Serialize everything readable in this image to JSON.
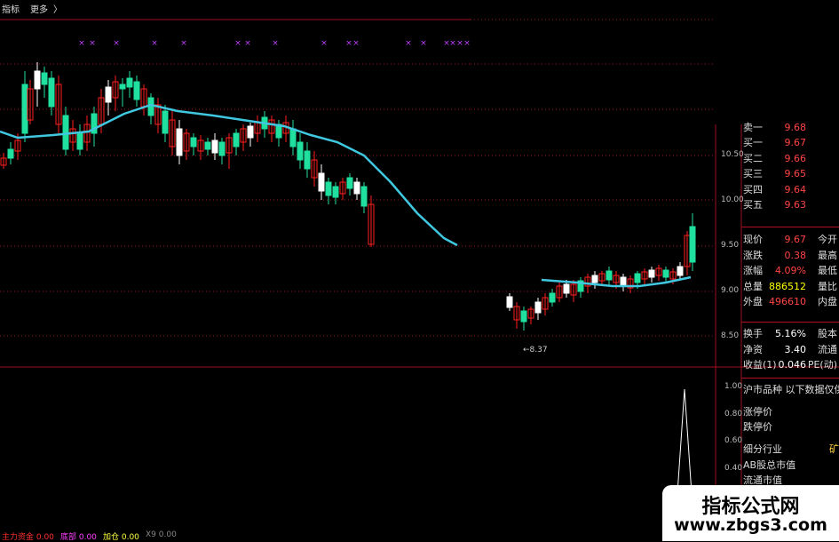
{
  "toolbar": {
    "item1": "指标",
    "item2": "更多",
    "item3": "〉"
  },
  "price_axis": [
    {
      "label": "10.50",
      "value": 10.5
    },
    {
      "label": "10.00",
      "value": 10.0
    },
    {
      "label": "9.50",
      "value": 9.5
    },
    {
      "label": "9.00",
      "value": 9.0
    },
    {
      "label": "8.50",
      "value": 8.5
    }
  ],
  "indicator_axis": [
    {
      "label": "1.00",
      "value": 1.0
    },
    {
      "label": "0.80",
      "value": 0.8
    },
    {
      "label": "0.60",
      "value": 0.6
    },
    {
      "label": "0.40",
      "value": 0.4
    }
  ],
  "min_price_label": "8.37",
  "quote_panel": {
    "cut_top": {
      "label": "卖一",
      "value": "9.68"
    },
    "bids": [
      {
        "label": "买一",
        "value": "9.67"
      },
      {
        "label": "买二",
        "value": "9.66"
      },
      {
        "label": "买三",
        "value": "9.65"
      },
      {
        "label": "买四",
        "value": "9.64"
      },
      {
        "label": "买五",
        "value": "9.63"
      }
    ],
    "stats": [
      {
        "label": "现价",
        "value": "9.67",
        "label2": "今开",
        "color": "red"
      },
      {
        "label": "涨跌",
        "value": "0.38",
        "label2": "最高",
        "color": "red"
      },
      {
        "label": "涨幅",
        "value": "4.09%",
        "label2": "最低",
        "color": "red"
      },
      {
        "label": "总量",
        "value": "886512",
        "label2": "量比",
        "color": "yellow"
      },
      {
        "label": "外盘",
        "value": "496610",
        "label2": "内盘",
        "color": "red"
      }
    ],
    "fundamentals": [
      {
        "label": "换手",
        "value": "5.16%",
        "label2": "股本"
      },
      {
        "label": "净资",
        "value": "3.40",
        "label2": "流通"
      },
      {
        "label": "收益(1)",
        "value": "0.046",
        "label2": "PE(动)"
      }
    ]
  },
  "info_lines": {
    "header": "沪市品种  以下数据仅供",
    "limit_up": "涨停价",
    "limit_down": "跌停价",
    "industry": "细分行业",
    "industry_value": "矿",
    "ab_cap": "AB股总市值",
    "float_cap": "流通市值"
  },
  "indicator_bar": [
    {
      "label": "主力资金",
      "value": "0.00",
      "color": "#ff3030"
    },
    {
      "label": "底部",
      "value": "0.00",
      "color": "#ff40ff"
    },
    {
      "label": "加仓",
      "value": "0.00",
      "color": "#ffff40"
    },
    {
      "label": "X9",
      "value": "0.00",
      "color": "#888888"
    }
  ],
  "watermark": {
    "title": "指标公式网",
    "url": "www.zbgs3.com"
  },
  "colors": {
    "up": "#ff2020",
    "down": "#20e0a0",
    "ma": "#40c8e0",
    "grid": "#a01020",
    "marker": "#c040ff"
  }
}
